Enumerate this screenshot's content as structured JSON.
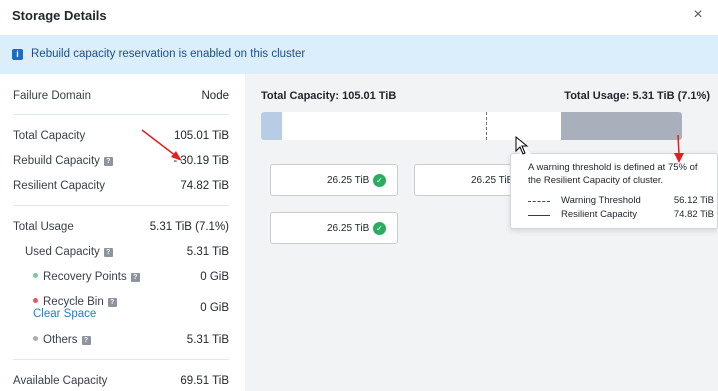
{
  "modal": {
    "title": "Storage Details",
    "close_icon": "×"
  },
  "banner": {
    "icon": "i",
    "text": "Rebuild capacity reservation is enabled on this cluster"
  },
  "details": {
    "failure_domain": {
      "label": "Failure Domain",
      "value": "Node"
    },
    "total_capacity": {
      "label": "Total Capacity",
      "value": "105.01 TiB"
    },
    "rebuild_capacity": {
      "label": "Rebuild Capacity",
      "value": "- 30.19 TiB"
    },
    "resilient_capacity": {
      "label": "Resilient Capacity",
      "value": "74.82 TiB"
    },
    "total_usage": {
      "label": "Total Usage",
      "value": "5.31 TiB (7.1%)"
    },
    "used_capacity": {
      "label": "Used Capacity",
      "value": "5.31 TiB"
    },
    "recovery_points": {
      "label": "Recovery Points",
      "value": "0 GiB",
      "color": "#7ecba1"
    },
    "recycle_bin": {
      "label": "Recycle Bin",
      "value": "0 GiB",
      "color": "#e0596b",
      "action": "Clear Space"
    },
    "others": {
      "label": "Others",
      "value": "5.31 TiB",
      "color": "#a6afb9"
    },
    "available_capacity": {
      "label": "Available Capacity",
      "value": "69.51 TiB"
    }
  },
  "capacity_bar": {
    "total_label": "Total Capacity: 105.01 TiB",
    "usage_label": "Total Usage: 5.31 TiB (7.1%)",
    "total_tib": 105.01,
    "usage_tib": 5.31,
    "rebuild_tib": 30.19,
    "warning_threshold_tib": 56.12,
    "usage_color": "#b7cde6",
    "rebuild_color": "#aab0bb"
  },
  "nodes": [
    {
      "value": "26.25 TiB",
      "status": "ok"
    },
    {
      "value": "26.25 TiB",
      "status": "ok"
    },
    {
      "value": "26.25 TiB",
      "status": "ok"
    }
  ],
  "tooltip": {
    "text": "A warning threshold is defined at 75% of the Resilient Capacity of cluster.",
    "legend": [
      {
        "name": "Warning Threshold",
        "value": "56.12 TiB",
        "style": "dashed"
      },
      {
        "name": "Resilient Capacity",
        "value": "74.82 TiB",
        "style": "solid"
      }
    ]
  },
  "help_icon": "?",
  "check_icon": "✓",
  "colors": {
    "accent": "#1b7fd4",
    "banner_bg": "#dbeefc",
    "ok": "#2aad61",
    "annotation": "#e02020"
  }
}
